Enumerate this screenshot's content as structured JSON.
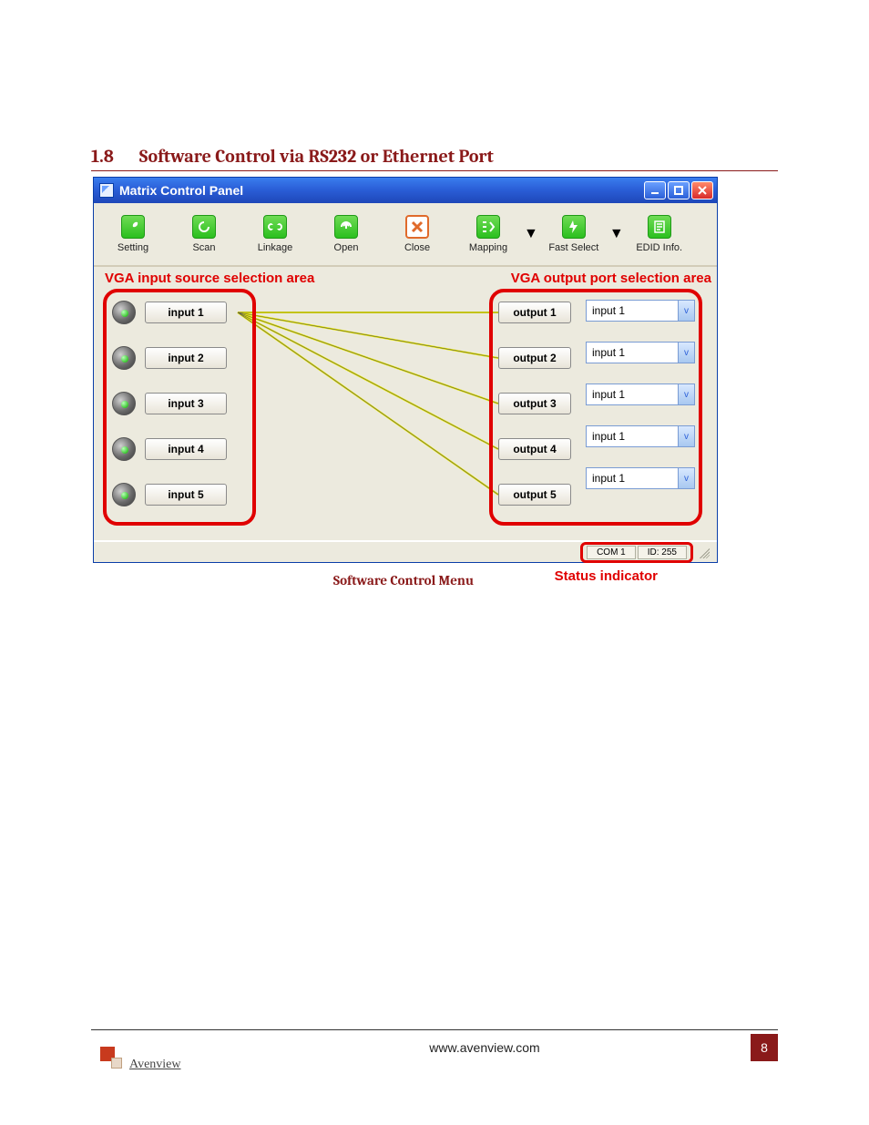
{
  "heading": {
    "num": "1.8",
    "title": "Software Control via RS232 or Ethernet Port"
  },
  "window": {
    "title": "Matrix Control Panel"
  },
  "toolbar": [
    {
      "id": "setting",
      "label": "Setting"
    },
    {
      "id": "scan",
      "label": "Scan"
    },
    {
      "id": "linkage",
      "label": "Linkage"
    },
    {
      "id": "open",
      "label": "Open"
    },
    {
      "id": "close",
      "label": "Close"
    },
    {
      "id": "mapping",
      "label": "Mapping",
      "dropdown": true
    },
    {
      "id": "fastselect",
      "label": "Fast Select",
      "dropdown": true
    },
    {
      "id": "edid",
      "label": "EDID Info."
    }
  ],
  "annotations": {
    "input_area": "VGA input source selection area",
    "output_area": "VGA output port selection area",
    "status": "Status indicator"
  },
  "inputs": [
    "input 1",
    "input 2",
    "input 3",
    "input 4",
    "input 5"
  ],
  "outputs": [
    {
      "label": "output 1",
      "selected": "input 1"
    },
    {
      "label": "output 2",
      "selected": "input 1"
    },
    {
      "label": "output 3",
      "selected": "input 1"
    },
    {
      "label": "output 4",
      "selected": "input 1"
    },
    {
      "label": "output 5",
      "selected": "input 1"
    }
  ],
  "status": {
    "port": "COM 1",
    "id": "ID: 255"
  },
  "caption": "Software Control Menu",
  "footer": {
    "url": "www.avenview.com",
    "page": "8",
    "brand": "Avenview"
  }
}
